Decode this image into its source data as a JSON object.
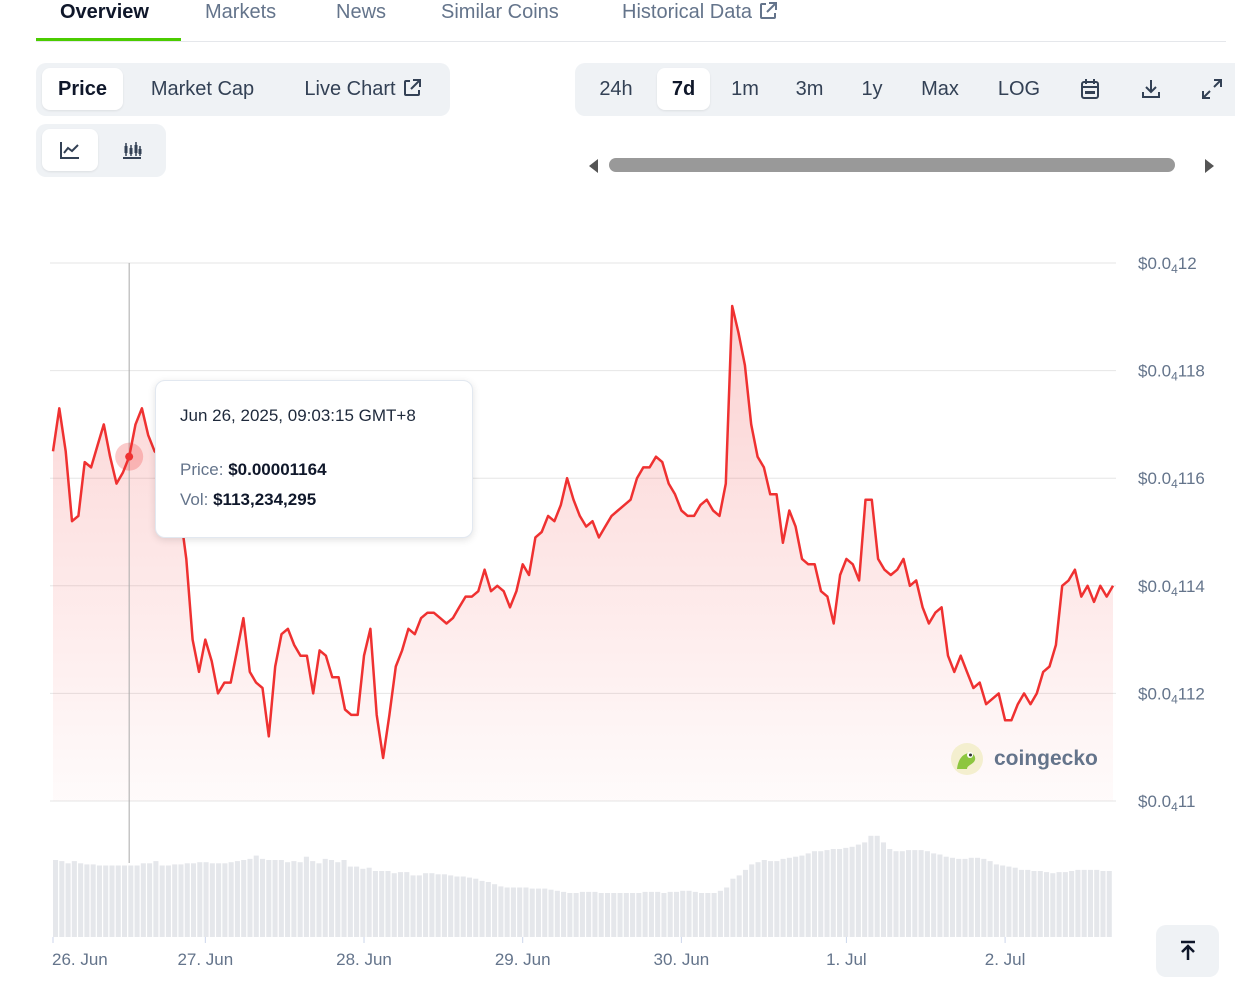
{
  "tabs": [
    {
      "label": "Overview",
      "active": true
    },
    {
      "label": "Markets"
    },
    {
      "label": "News"
    },
    {
      "label": "Similar Coins"
    },
    {
      "label": "Historical Data",
      "external": true
    }
  ],
  "chart_type_tabs": {
    "price": "Price",
    "market_cap": "Market Cap",
    "live_chart": "Live Chart",
    "selected": "Price"
  },
  "view_toggle": {
    "line_icon": "line-chart-icon",
    "candle_icon": "candlestick-icon",
    "selected": "line"
  },
  "ranges": {
    "options": [
      "24h",
      "7d",
      "1m",
      "3m",
      "1y",
      "Max",
      "LOG"
    ],
    "selected": "7d",
    "icons": [
      "calendar-icon",
      "download-icon",
      "expand-icon"
    ]
  },
  "tooltip": {
    "date": "Jun 26, 2025, 09:03:15 GMT+8",
    "price_label": "Price:",
    "price_value": "$0.00001164",
    "vol_label": "Vol:",
    "vol_value": "$113,234,295"
  },
  "watermark": "coingecko",
  "colors": {
    "line": "#ef3131",
    "accent": "#4bcc00",
    "volume": "#e5e7eb"
  },
  "chart_data": {
    "type": "line",
    "series": [
      {
        "values": [
          11.65,
          11.73,
          11.65,
          11.52,
          11.53,
          11.63,
          11.62,
          11.66,
          11.7,
          11.64,
          11.59,
          11.61,
          11.64,
          11.7,
          11.73,
          11.68,
          11.65,
          11.64,
          11.62,
          11.58,
          11.54,
          11.45,
          11.3,
          11.24,
          11.3,
          11.26,
          11.2,
          11.22,
          11.22,
          11.28,
          11.34,
          11.24,
          11.22,
          11.21,
          11.12,
          11.25,
          11.31,
          11.32,
          11.29,
          11.27,
          11.27,
          11.2,
          11.28,
          11.27,
          11.23,
          11.23,
          11.17,
          11.16,
          11.16,
          11.27,
          11.32,
          11.16,
          11.08,
          11.16,
          11.25,
          11.28,
          11.32,
          11.31,
          11.34,
          11.35,
          11.35,
          11.34,
          11.33,
          11.34,
          11.36,
          11.38,
          11.38,
          11.39,
          11.43,
          11.39,
          11.4,
          11.39,
          11.36,
          11.39,
          11.44,
          11.42,
          11.49,
          11.5,
          11.53,
          11.52,
          11.55,
          11.6,
          11.56,
          11.53,
          11.51,
          11.52,
          11.49,
          11.51,
          11.53,
          11.54,
          11.55,
          11.56,
          11.6,
          11.62,
          11.62,
          11.64,
          11.63,
          11.59,
          11.57,
          11.54,
          11.53,
          11.53,
          11.55,
          11.56,
          11.54,
          11.53,
          11.59,
          11.92,
          11.87,
          11.81,
          11.7,
          11.64,
          11.62,
          11.57,
          11.57,
          11.48,
          11.54,
          11.51,
          11.45,
          11.44,
          11.44,
          11.39,
          11.38,
          11.33,
          11.42,
          11.45,
          11.44,
          11.41,
          11.56,
          11.56,
          11.45,
          11.43,
          11.42,
          11.43,
          11.45,
          11.4,
          11.41,
          11.36,
          11.33,
          11.35,
          11.36,
          11.27,
          11.24,
          11.27,
          11.24,
          11.21,
          11.22,
          11.18,
          11.19,
          11.2,
          11.15,
          11.15,
          11.18,
          11.2,
          11.18,
          11.2,
          11.24,
          11.25,
          11.29,
          11.4,
          11.41,
          11.43,
          11.38,
          11.4,
          11.37,
          11.4,
          11.38,
          11.4
        ]
      }
    ],
    "y_tick_labels": [
      {
        "value": 12.0,
        "prefix": "$0.0",
        "sub": "4",
        "suffix": "12"
      },
      {
        "value": 11.8,
        "prefix": "$0.0",
        "sub": "4",
        "suffix": "118"
      },
      {
        "value": 11.6,
        "prefix": "$0.0",
        "sub": "4",
        "suffix": "116"
      },
      {
        "value": 11.4,
        "prefix": "$0.0",
        "sub": "4",
        "suffix": "114"
      },
      {
        "value": 11.2,
        "prefix": "$0.0",
        "sub": "4",
        "suffix": "112"
      },
      {
        "value": 11.0,
        "prefix": "$0.0",
        "sub": "4",
        "suffix": "11"
      }
    ],
    "ylim": [
      11.0,
      12.0
    ],
    "x_tick_labels": [
      "26. Jun",
      "27. Jun",
      "28. Jun",
      "29. Jun",
      "30. Jun",
      "1. Jul",
      "2. Jul"
    ],
    "x_tick_index": [
      0,
      24,
      49,
      74,
      99,
      125,
      150
    ],
    "hover_index": 12,
    "volume": [
      0.7,
      0.69,
      0.67,
      0.69,
      0.67,
      0.66,
      0.66,
      0.65,
      0.65,
      0.65,
      0.65,
      0.65,
      0.65,
      0.65,
      0.67,
      0.67,
      0.69,
      0.65,
      0.65,
      0.66,
      0.66,
      0.67,
      0.67,
      0.68,
      0.68,
      0.67,
      0.67,
      0.67,
      0.68,
      0.69,
      0.7,
      0.71,
      0.74,
      0.71,
      0.7,
      0.7,
      0.7,
      0.68,
      0.69,
      0.68,
      0.73,
      0.69,
      0.67,
      0.71,
      0.7,
      0.68,
      0.7,
      0.64,
      0.64,
      0.62,
      0.63,
      0.6,
      0.6,
      0.6,
      0.58,
      0.59,
      0.59,
      0.56,
      0.56,
      0.58,
      0.58,
      0.57,
      0.57,
      0.56,
      0.55,
      0.55,
      0.54,
      0.53,
      0.51,
      0.5,
      0.48,
      0.46,
      0.45,
      0.45,
      0.45,
      0.45,
      0.44,
      0.44,
      0.44,
      0.43,
      0.42,
      0.41,
      0.4,
      0.4,
      0.41,
      0.41,
      0.41,
      0.4,
      0.4,
      0.4,
      0.4,
      0.4,
      0.4,
      0.4,
      0.41,
      0.41,
      0.41,
      0.4,
      0.41,
      0.41,
      0.42,
      0.42,
      0.41,
      0.4,
      0.4,
      0.4,
      0.42,
      0.45,
      0.53,
      0.56,
      0.61,
      0.66,
      0.68,
      0.7,
      0.69,
      0.69,
      0.71,
      0.72,
      0.73,
      0.74,
      0.76,
      0.78,
      0.78,
      0.79,
      0.8,
      0.8,
      0.81,
      0.82,
      0.84,
      0.86,
      0.92,
      0.92,
      0.86,
      0.8,
      0.78,
      0.78,
      0.79,
      0.79,
      0.79,
      0.78,
      0.76,
      0.75,
      0.73,
      0.72,
      0.71,
      0.71,
      0.72,
      0.72,
      0.71,
      0.69,
      0.66,
      0.65,
      0.64,
      0.63,
      0.61,
      0.61,
      0.6,
      0.6,
      0.59,
      0.58,
      0.59,
      0.59,
      0.6,
      0.61,
      0.61,
      0.61,
      0.61,
      0.6,
      0.6
    ]
  }
}
